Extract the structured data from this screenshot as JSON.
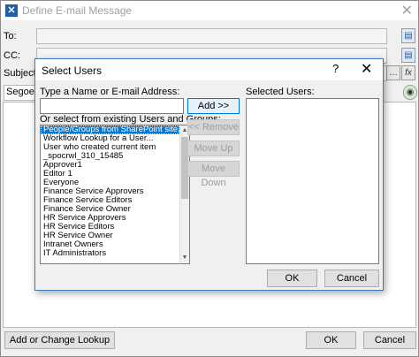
{
  "outer": {
    "title": "Define E-mail Message",
    "fields": {
      "to_label": "To:",
      "cc_label": "CC:",
      "subject_label": "Subject:",
      "font_value": "Segoe UI"
    },
    "buttons": {
      "lookup": "Add or Change Lookup",
      "ok": "OK",
      "cancel": "Cancel"
    }
  },
  "dialog": {
    "title": "Select Users",
    "help_glyph": "?",
    "close_glyph": "✕",
    "name_label": "Type a Name or E-mail Address:",
    "name_input_value": "",
    "groups_label": "Or select from existing Users and Groups:",
    "selected_label": "Selected Users:",
    "users": [
      "People/Groups from SharePoint site...",
      "Workflow Lookup for a User...",
      "User who created current item",
      "_spocrwl_310_15485",
      "Approver1",
      "Editor 1",
      "Everyone",
      "Finance Service Approvers",
      "Finance Service Editors",
      "Finance Service Owner",
      "HR Service Approvers",
      "HR Service Editors",
      "HR Service Owner",
      "Intranet Owners",
      "IT Administrators"
    ],
    "buttons": {
      "add": "Add >>",
      "remove": "<< Remove",
      "move_up": "Move Up",
      "move_down": "Move Down",
      "ok": "OK",
      "cancel": "Cancel"
    }
  },
  "colors": {
    "selection": "#0078d7",
    "dialog_border": "#3c7ac0"
  }
}
